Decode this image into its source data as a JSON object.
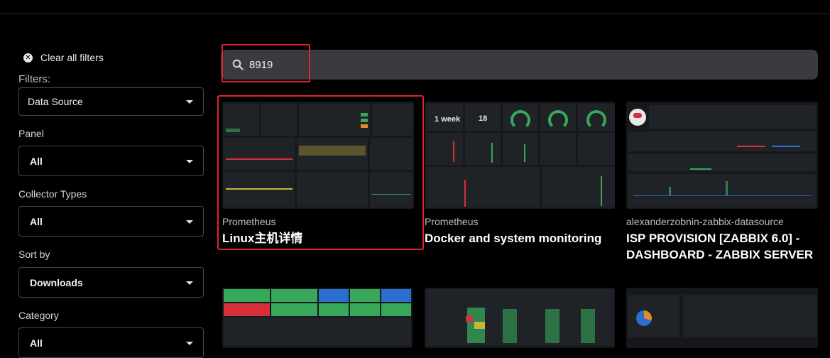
{
  "sidebar": {
    "clear_all": "Clear all filters",
    "filters_label": "Filters:",
    "data_source": {
      "value": "Data Source"
    },
    "panel": {
      "label": "Panel",
      "value": "All"
    },
    "collector_types": {
      "label": "Collector Types",
      "value": "All"
    },
    "sort_by": {
      "label": "Sort by",
      "value": "Downloads"
    },
    "category": {
      "label": "Category",
      "value": "All"
    }
  },
  "search": {
    "value": "8919"
  },
  "cards": [
    {
      "source": "Prometheus",
      "title": "Linux主机详情"
    },
    {
      "source": "Prometheus",
      "title": "Docker and system monitoring",
      "thumb_stats": [
        "1 week",
        "18"
      ]
    },
    {
      "source": "alexanderzobnin-zabbix-datasource",
      "title": "ISP PROVISION [ZABBIX 6.0] - DASHBOARD - ZABBIX SERVER"
    }
  ],
  "colors": {
    "highlight": "#e0242c",
    "green": "#37a85a",
    "red": "#d8303a",
    "blue": "#2a6fd0"
  }
}
